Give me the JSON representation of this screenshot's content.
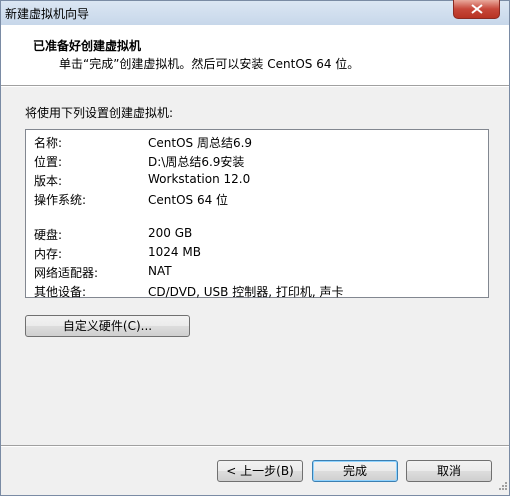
{
  "window": {
    "title": "新建虚拟机向导"
  },
  "header": {
    "title": "已准备好创建虚拟机",
    "subtitle": "单击“完成”创建虚拟机。然后可以安装 CentOS 64 位。"
  },
  "intro_text": "将使用下列设置创建虚拟机:",
  "summary": {
    "group1": [
      {
        "key": "名称:",
        "value": "CentOS 周总结6.9"
      },
      {
        "key": "位置:",
        "value": "D:\\周总结6.9安装"
      },
      {
        "key": "版本:",
        "value": "Workstation 12.0"
      },
      {
        "key": "操作系统:",
        "value": "CentOS 64 位"
      }
    ],
    "group2": [
      {
        "key": "硬盘:",
        "value": "200 GB"
      },
      {
        "key": "内存:",
        "value": "1024 MB"
      },
      {
        "key": "网络适配器:",
        "value": "NAT"
      },
      {
        "key": "其他设备:",
        "value": "CD/DVD, USB 控制器, 打印机, 声卡"
      }
    ]
  },
  "buttons": {
    "customize": "自定义硬件(C)...",
    "back": "< 上一步(B)",
    "finish": "完成",
    "cancel": "取消"
  },
  "icons": {
    "close": "close-icon",
    "grip": "resize-grip-icon"
  },
  "colors": {
    "close_button": "#c7473a",
    "default_button_border": "#3c7fb1"
  }
}
